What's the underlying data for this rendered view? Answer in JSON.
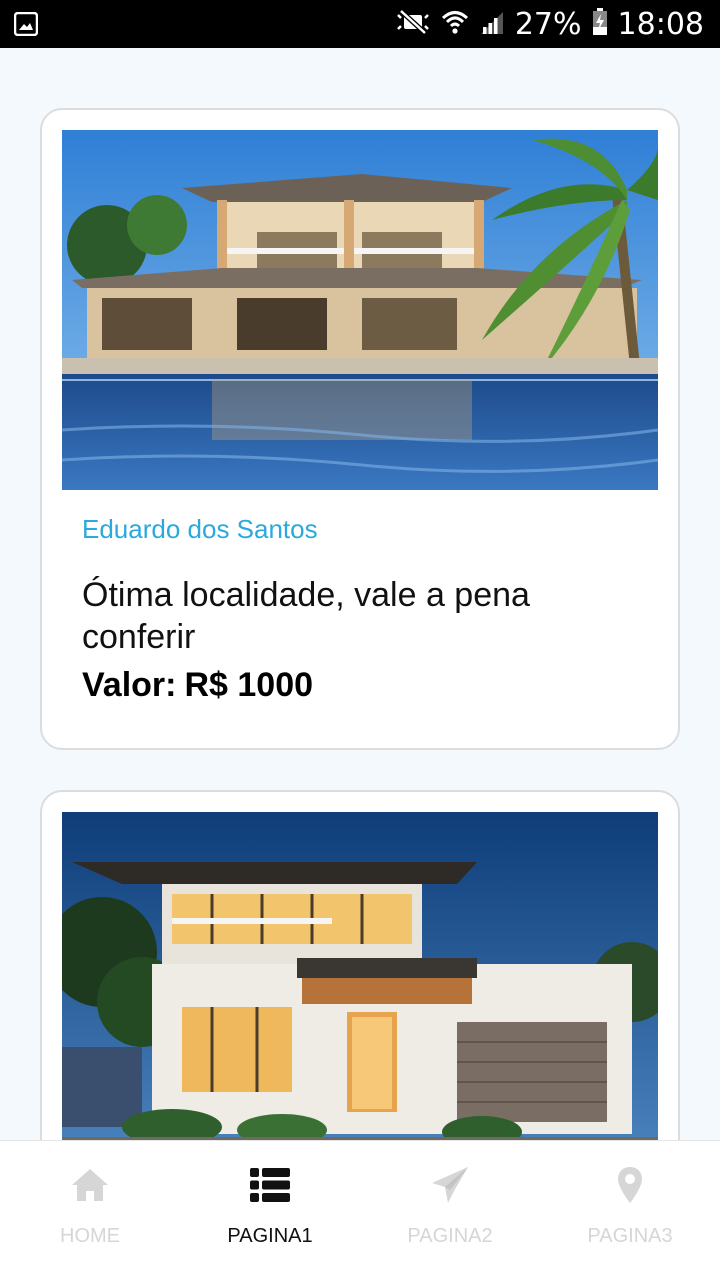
{
  "status_bar": {
    "battery": "27%",
    "time": "18:08",
    "icons": [
      "image-icon",
      "mute-icon",
      "wifi-icon",
      "signal-icon",
      "battery-icon"
    ]
  },
  "listings": [
    {
      "author": "Eduardo dos Santos",
      "description": "Ótima localidade, vale a pena conferir",
      "price_label": "Valor:",
      "price": "R$ 1000",
      "image": "house-with-pool-photo"
    },
    {
      "image": "modern-house-photo"
    }
  ],
  "tabs": [
    {
      "label": "HOME",
      "icon": "home-icon",
      "active": false
    },
    {
      "label": "PAGINA1",
      "icon": "list-icon",
      "active": true
    },
    {
      "label": "PAGINA2",
      "icon": "paper-plane-icon",
      "active": false
    },
    {
      "label": "PAGINA3",
      "icon": "map-pin-icon",
      "active": false
    }
  ],
  "colors": {
    "accent": "#29a9e0",
    "background": "#f4f9fe",
    "tab_inactive": "#d6d6d6",
    "tab_active": "#111111"
  }
}
